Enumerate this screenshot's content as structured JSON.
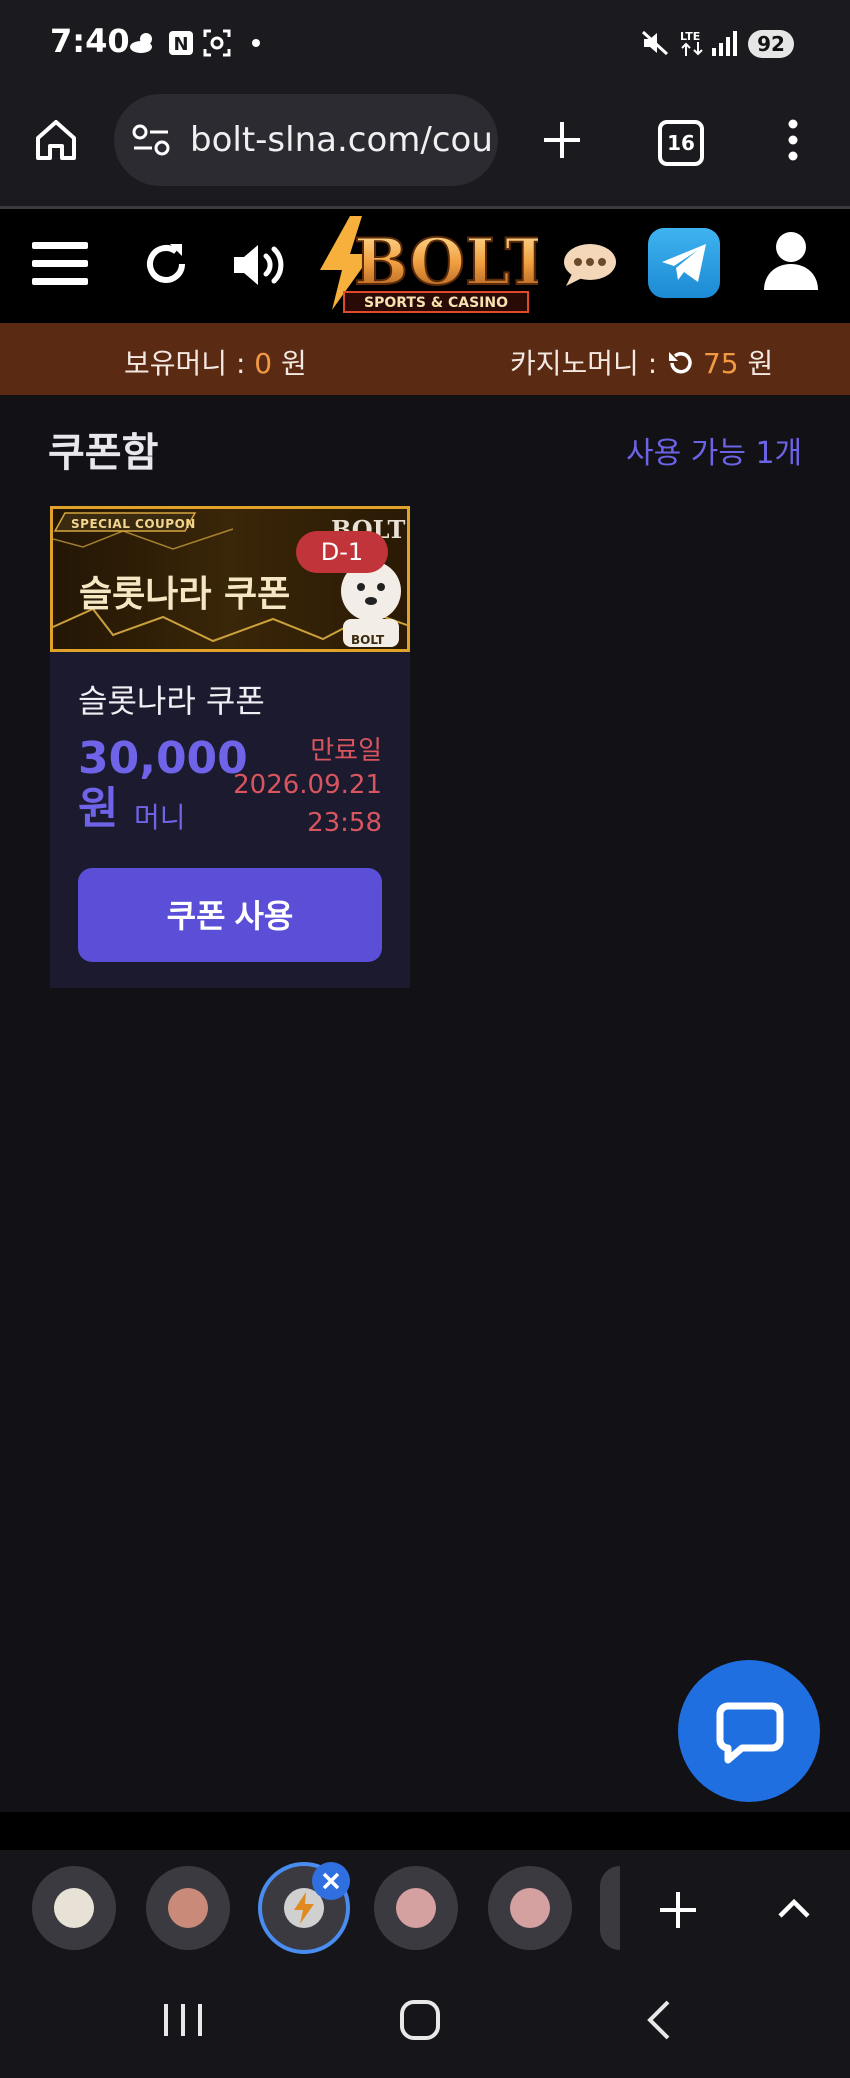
{
  "status_bar": {
    "time": "7:40",
    "battery": "92",
    "network": "LTE"
  },
  "browser": {
    "url": "bolt-slna.com/cou",
    "tab_count": "16"
  },
  "site": {
    "logo_text": "BOLT",
    "logo_subtext": "SPORTS & CASINO"
  },
  "money": {
    "hold_label": "보유머니 :",
    "hold_value": "0",
    "hold_unit": "원",
    "casino_label": "카지노머니 :",
    "casino_value": "75",
    "casino_unit": "원"
  },
  "page": {
    "title": "쿠폰함",
    "available": "사용 가능 1개"
  },
  "coupon": {
    "banner_tag": "SPECIAL COUPON",
    "banner_title": "슬롯나라 쿠폰",
    "banner_brand": "BOLT",
    "dday": "D-1",
    "name": "슬롯나라 쿠폰",
    "amount": "30,000 원",
    "unit": "머니",
    "expiry_label": "만료일",
    "expiry_date": "2026.09.21",
    "expiry_time": "23:58",
    "use_button": "쿠폰 사용"
  },
  "colors": {
    "accent": "#5a4fd6",
    "money_bar": "#5a2a12",
    "expiry": "#d8555f",
    "amount": "#6f64e8"
  }
}
